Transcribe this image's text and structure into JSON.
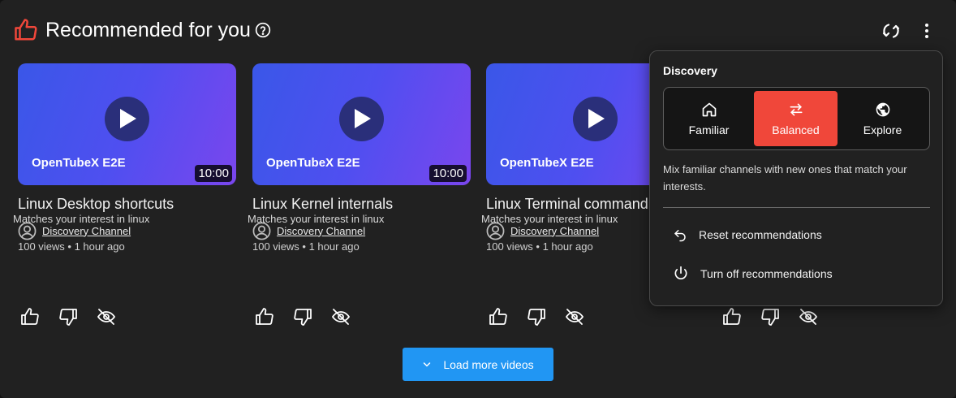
{
  "header": {
    "title": "Recommended for you",
    "accent_color": "#f0473a"
  },
  "cards": [
    {
      "brand": "OpenTubeX E2E",
      "duration": "10:00",
      "title": "Linux Desktop shortcuts",
      "channel": "Discovery Channel",
      "meta": "100 views • 1 hour ago",
      "reason": "Matches your interest in linux"
    },
    {
      "brand": "OpenTubeX E2E",
      "duration": "10:00",
      "title": "Linux Kernel internals",
      "channel": "Discovery Channel",
      "meta": "100 views • 1 hour ago",
      "reason": "Matches your interest in linux"
    },
    {
      "brand": "OpenTubeX E2E",
      "duration": "",
      "title": "Linux Terminal commands",
      "channel": "Discovery Channel",
      "meta": "100 views • 1 hour ago",
      "reason": "Matches your interest in linux"
    }
  ],
  "load_more": {
    "label": "Load more videos",
    "color": "#2196f3"
  },
  "menu": {
    "title": "Discovery",
    "options": [
      {
        "label": "Familiar",
        "icon": "home-icon",
        "active": false
      },
      {
        "label": "Balanced",
        "icon": "swap-arrows-icon",
        "active": true
      },
      {
        "label": "Explore",
        "icon": "globe-icon",
        "active": false
      }
    ],
    "description": "Mix familiar channels with new ones that match your interests.",
    "reset_label": "Reset recommendations",
    "turn_off_label": "Turn off recommendations"
  }
}
